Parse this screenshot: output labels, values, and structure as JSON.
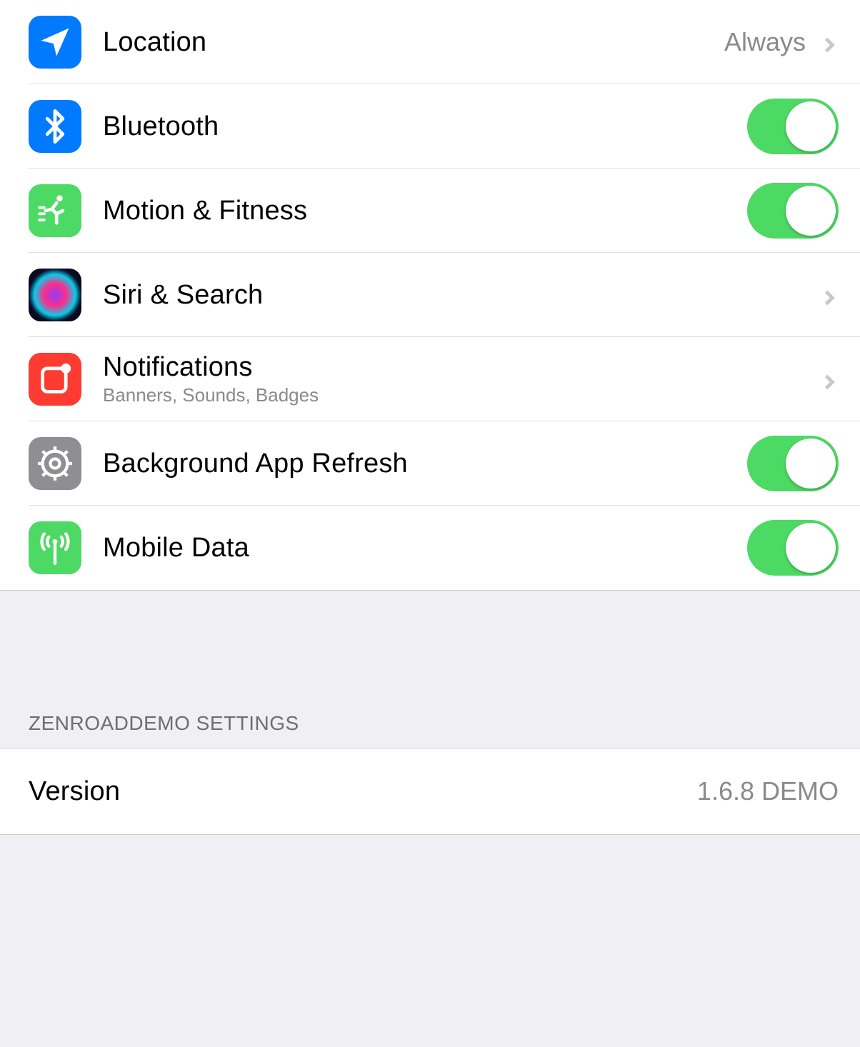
{
  "permissions": {
    "location": {
      "label": "Location",
      "detail": "Always"
    },
    "bluetooth": {
      "label": "Bluetooth"
    },
    "motion": {
      "label": "Motion & Fitness"
    },
    "siri": {
      "label": "Siri & Search"
    },
    "notifications": {
      "label": "Notifications",
      "subtitle": "Banners, Sounds, Badges"
    },
    "background": {
      "label": "Background App Refresh"
    },
    "mobiledata": {
      "label": "Mobile Data"
    }
  },
  "section": {
    "header": "ZENROADDEMO SETTINGS",
    "version_label": "Version",
    "version_value": "1.6.8 DEMO"
  }
}
